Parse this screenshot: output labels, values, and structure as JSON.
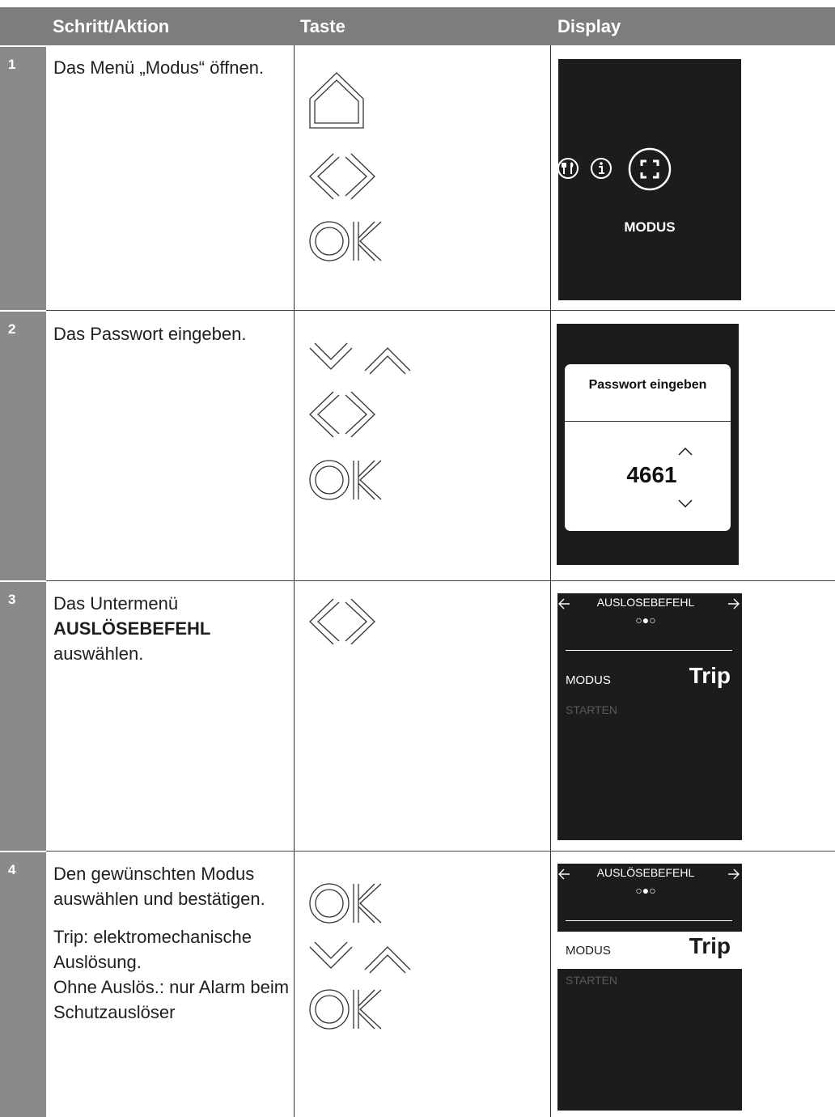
{
  "header": {
    "col_step": "Schritt/Aktion",
    "col_key": "Taste",
    "col_display": "Display"
  },
  "rows": [
    {
      "num": "1",
      "text": "Das Menü „Modus“ öffnen.",
      "keys": [
        "home-key",
        "left-right-keys",
        "ok-key"
      ],
      "display": {
        "label": "MODUS",
        "icons": [
          "tools-icon",
          "info-icon",
          "modus-icon"
        ]
      }
    },
    {
      "num": "2",
      "text": "Das Passwort eingeben.",
      "keys": [
        "down-up-keys",
        "left-right-keys",
        "ok-key"
      ],
      "display": {
        "dialog_title": "Passwort eingeben",
        "password": "4661"
      }
    },
    {
      "num": "3",
      "text_line1": "Das Untermenü",
      "text_bold": "AUSLÖSEBEFEHL",
      "text_line3": "auswählen.",
      "keys": [
        "left-right-keys"
      ],
      "display": {
        "title": "AUSLOSEBEFEHL",
        "dots": "○●○",
        "mode_label": "MODUS",
        "mode_value": "Trip",
        "start_label": "STARTEN"
      }
    },
    {
      "num": "4",
      "text": "Den gewünschten Modus auswählen und bestätigen.",
      "text_p2": "Trip: elektromechanische Auslösung.",
      "text_p3": "Ohne Auslös.: nur Alarm beim Schutzauslöser",
      "keys": [
        "ok-key",
        "down-up-keys",
        "ok-key"
      ],
      "display": {
        "title": "AUSLÖSEBEFEHL",
        "dots": "○●○",
        "mode_label": "MODUS",
        "mode_value": "Trip",
        "start_label": "STARTEN"
      }
    }
  ],
  "colors": {
    "header_bg": "#7d7d7d",
    "number_bg": "#8a8a8a",
    "display_bg": "#1c1c1c"
  }
}
